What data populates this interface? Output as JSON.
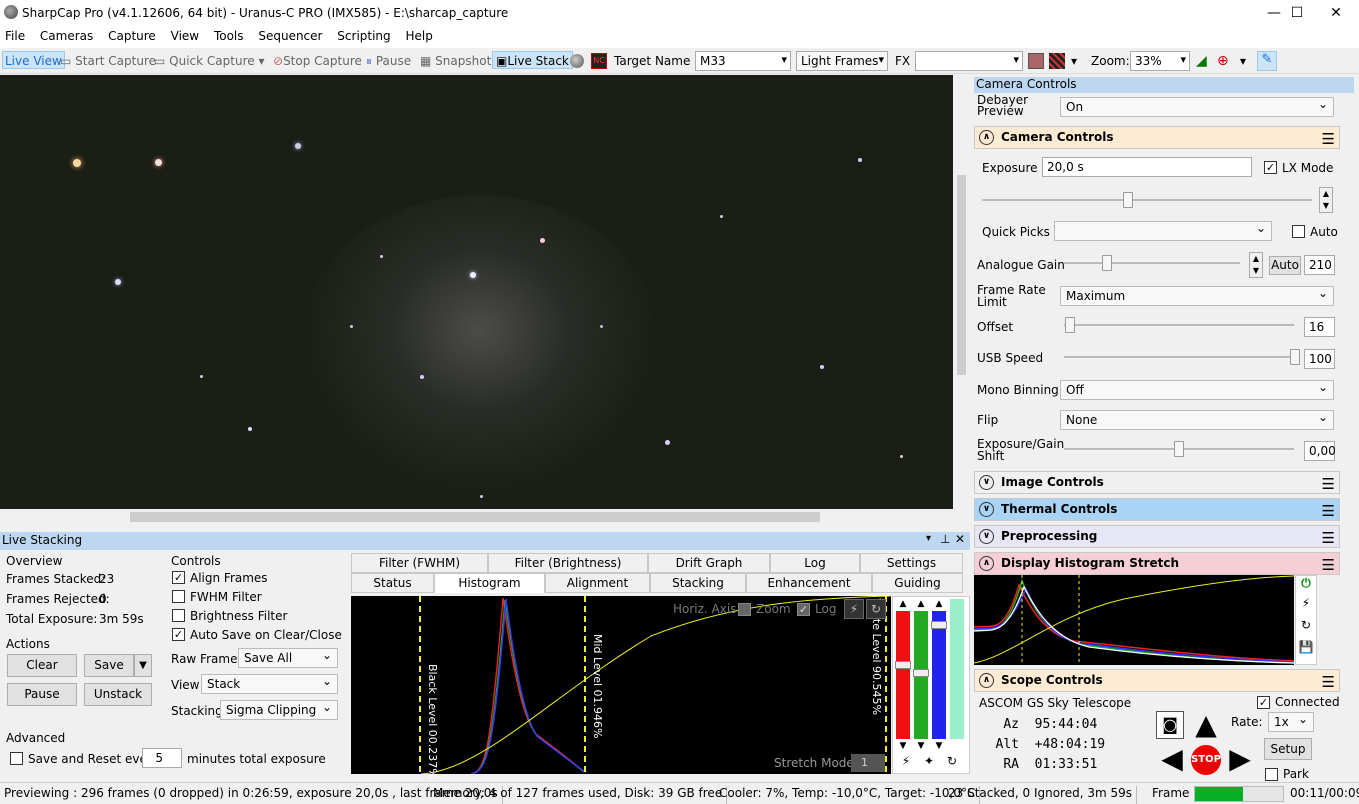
{
  "window": {
    "title": "SharpCap Pro (v4.1.12606, 64 bit) - Uranus-C PRO (IMX585) - E:\\sharcap_capture"
  },
  "menu": [
    "File",
    "Cameras",
    "Capture",
    "View",
    "Tools",
    "Sequencer",
    "Scripting",
    "Help"
  ],
  "toolbar": {
    "live_view": "Live View",
    "start_capture": "Start Capture",
    "quick_capture": "Quick Capture",
    "stop_capture": "Stop Capture",
    "pause": "Pause",
    "snapshot": "Snapshot",
    "live_stack": "Live Stack",
    "target_label": "Target Name :",
    "target_value": "M33",
    "frame_type": "Light Frames",
    "fx_label": "FX",
    "fx_value": "",
    "zoom_label": "Zoom:",
    "zoom_value": "33%"
  },
  "camera_controls": {
    "panel_title": "Camera Controls",
    "debayer_label": "Debayer Preview",
    "debayer_value": "On",
    "section_title": "Camera Controls",
    "exposure_label": "Exposure",
    "exposure_value": "20,0 s",
    "lx_mode": "LX Mode",
    "quick_picks": "Quick Picks",
    "auto": "Auto",
    "analogue_gain_label": "Analogue Gain",
    "auto_btn": "Auto",
    "analogue_gain_value": "210",
    "frame_rate_label": "Frame Rate Limit",
    "frame_rate_value": "Maximum",
    "offset_label": "Offset",
    "offset_value": "16",
    "usb_label": "USB Speed",
    "usb_value": "100",
    "mono_label": "Mono Binning",
    "mono_value": "Off",
    "flip_label": "Flip",
    "flip_value": "None",
    "egs_label": "Exposure/Gain Shift",
    "egs_value": "0,00"
  },
  "sections": {
    "image": "Image Controls",
    "thermal": "Thermal Controls",
    "preprocessing": "Preprocessing",
    "display": "Display Histogram Stretch",
    "scope": "Scope Controls"
  },
  "scope": {
    "name": "ASCOM GS Sky Telescope",
    "connected": "Connected",
    "az_label": "Az",
    "az": "95:44:04",
    "alt_label": "Alt",
    "alt": "+48:04:19",
    "ra_label": "RA",
    "ra": "01:33:51",
    "rate_label": "Rate:",
    "rate": "1x",
    "setup": "Setup",
    "park": "Park",
    "stop": "STOP"
  },
  "live_stacking": {
    "title": "Live Stacking",
    "overview": "Overview",
    "frames_stacked_label": "Frames Stacked:",
    "frames_stacked": "23",
    "frames_rejected_label": "Frames Rejected:",
    "frames_rejected": "0",
    "total_exposure_label": "Total Exposure:",
    "total_exposure": "3m 59s",
    "actions": "Actions",
    "clear": "Clear",
    "save": "Save",
    "pause": "Pause",
    "unstack": "Unstack",
    "advanced": "Advanced",
    "save_reset": "Save and Reset every",
    "save_reset_value": "5",
    "minutes": "minutes total exposure",
    "controls": "Controls",
    "align_frames": "Align Frames",
    "fwhm_filter": "FWHM Filter",
    "brightness_filter": "Brightness Filter",
    "auto_save": "Auto Save on Clear/Close",
    "raw_frames_label": "Raw Frames",
    "raw_frames_value": "Save All",
    "view_label": "View",
    "view_value": "Stack",
    "stacking_label": "Stacking",
    "stacking_value": "Sigma Clipping"
  },
  "tabs_top": [
    "Filter (FWHM)",
    "Filter (Brightness)",
    "Drift Graph",
    "Log",
    "Settings"
  ],
  "tabs_bottom": [
    "Status",
    "Histogram",
    "Alignment",
    "Stacking",
    "Enhancement",
    "Guiding"
  ],
  "histogram": {
    "horiz_axis": "Horiz. Axis:",
    "zoom": "Zoom",
    "log": "Log",
    "black_level": "Black Level 00.237%",
    "mid_level": "Mid Level 01.946%",
    "white_level": "White Level 90.545%",
    "stretch_mode": "Stretch Mode",
    "stretch_value": "1"
  },
  "status": {
    "previewing": "Previewing : 296 frames (0 dropped) in 0:26:59, exposure 20,0s , last frame 20,0s",
    "memory": "Memory: 4 of 127 frames used, Disk: 39 GB free",
    "cooler": "Cooler: 7%, Temp: -10,0°C, Target: -10,0°C",
    "stacked": "23 Stacked, 0 Ignored, 3m 59s",
    "frame_label": "Frame :",
    "frame_time": "00:11/00:09",
    "frame_progress": 0.55
  }
}
